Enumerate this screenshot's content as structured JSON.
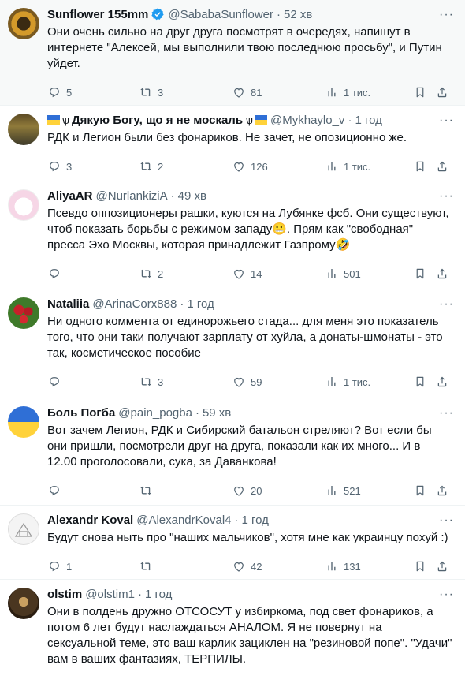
{
  "icons": {
    "reply": "reply-icon",
    "repost": "repost-icon",
    "like": "like-icon",
    "views": "views-icon",
    "bookmark": "bookmark-icon",
    "share": "share-icon",
    "more": "more-icon"
  },
  "colors": {
    "muted": "#536471",
    "verified": "#1d9bf0",
    "highlight_bg": "#f7f9f9"
  },
  "posts": [
    {
      "name": "Sunflower 155mm",
      "handle": "@SababaSunflower",
      "time": "52 хв",
      "verified": true,
      "text": "Они очень сильно на друг друга посмотрят в очередях, напишут в интернете \"Алексей, мы выполнили твою последнюю просьбу\", и Путин уйдет.",
      "replies": "5",
      "reposts": "3",
      "likes": "81",
      "views": "1 тис."
    },
    {
      "name": "Дякую Богу, що я не москаль",
      "handle": "@Mykhaylo_v",
      "time": "1 год",
      "text": "РДК и Легион были без фонариков. Не зачет, не опозиционно же.",
      "replies": "3",
      "reposts": "2",
      "likes": "126",
      "views": "1 тис."
    },
    {
      "name": "AliyaAR",
      "handle": "@NurlankiziA",
      "time": "49 хв",
      "text": "Псевдо оппозиционеры рашки, куются на Лубянке фсб. Они существуют, чтоб показать борьбы с режимом западу😬. Прям как \"свободная\" пресса Эхо Москвы, которая принадлежит Газпрому🤣",
      "replies": "",
      "reposts": "2",
      "likes": "14",
      "views": "501"
    },
    {
      "name": "Nataliia",
      "handle": "@ArinaCorx888",
      "time": "1 год",
      "text": "Ни одного коммента от единорожьего стада... для меня это показатель того, что они таки получают зарплату от хуйла, а донаты-шмонаты - это так, косметическое пособие",
      "replies": "",
      "reposts": "3",
      "likes": "59",
      "views": "1 тис."
    },
    {
      "name": "Боль Погба",
      "handle": "@pain_pogba",
      "time": "59 хв",
      "text": "Вот зачем Легион, РДК и Сибирский батальон стреляют? Вот если бы они пришли, посмотрели друг на друга, показали как их много... И в 12.00 проголосовали, сука, за Даванкова!",
      "replies": "",
      "reposts": "",
      "likes": "20",
      "views": "521"
    },
    {
      "name": "Alexandr Koval",
      "handle": "@AlexandrKoval4",
      "time": "1 год",
      "text": "Будут снова ныть про \"наших мальчиков\", хотя мне как украинцу похуй :)",
      "replies": "1",
      "reposts": "",
      "likes": "42",
      "views": "131"
    },
    {
      "name": "olstim",
      "handle": "@olstim1",
      "time": "1 год",
      "text": "Они в полдень дружно ОТСОСУТ у избиркома, под свет фонариков, а потом 6 лет будут наслаждаться АНАЛОМ. Я не повернут на сексуальной теме, это ваш карлик зациклен на \"резиновой попе\". \"Удачи\" вам в ваших фантазиях, ТЕРПИЛЫ.",
      "replies": "",
      "reposts": "",
      "likes": "",
      "views": ""
    }
  ]
}
